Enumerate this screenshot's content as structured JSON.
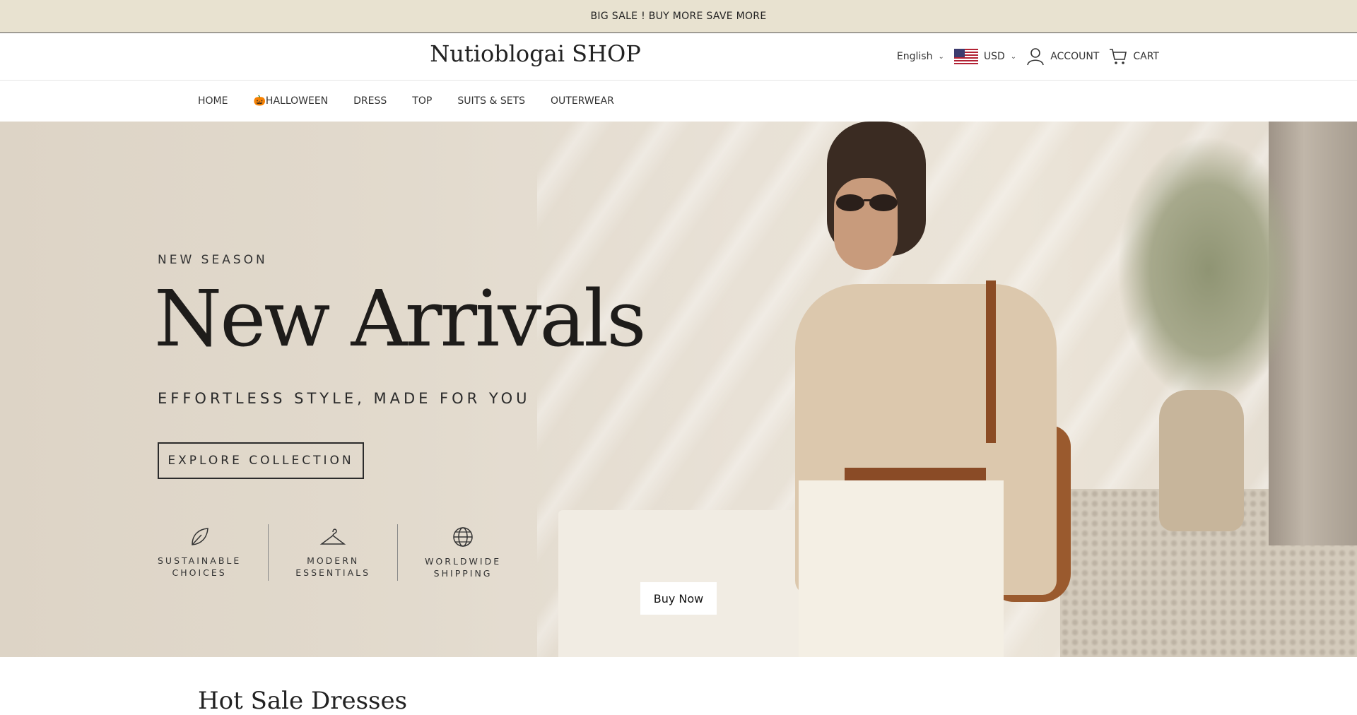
{
  "announcement": {
    "text": "BIG SALE ! BUY MORE SAVE MORE"
  },
  "header": {
    "logo": "Nutioblogai SHOP",
    "language": "English",
    "currency": "USD",
    "account_label": "ACCOUNT",
    "cart_label": "CART"
  },
  "nav": {
    "items": [
      "HOME",
      "🎃HALLOWEEN",
      "DRESS",
      "TOP",
      "SUITS & SETS",
      "OUTERWEAR"
    ]
  },
  "hero": {
    "eyebrow": "NEW SEASON",
    "headline": "New Arrivals",
    "subline": "EFFORTLESS STYLE, MADE FOR YOU",
    "cta": "EXPLORE COLLECTION",
    "features": [
      {
        "line1": "SUSTAINABLE",
        "line2": "CHOICES",
        "icon": "leaf-icon"
      },
      {
        "line1": "MODERN",
        "line2": "ESSENTIALS",
        "icon": "hanger-icon"
      },
      {
        "line1": "WORLDWIDE",
        "line2": "SHIPPING",
        "icon": "globe-icon"
      }
    ],
    "buy_now": "Buy Now"
  },
  "section": {
    "title": "Hot Sale Dresses"
  },
  "colors": {
    "announcement_bg": "#e8e2d0",
    "hero_bg": "#e2dacd",
    "text_dark": "#222222"
  }
}
